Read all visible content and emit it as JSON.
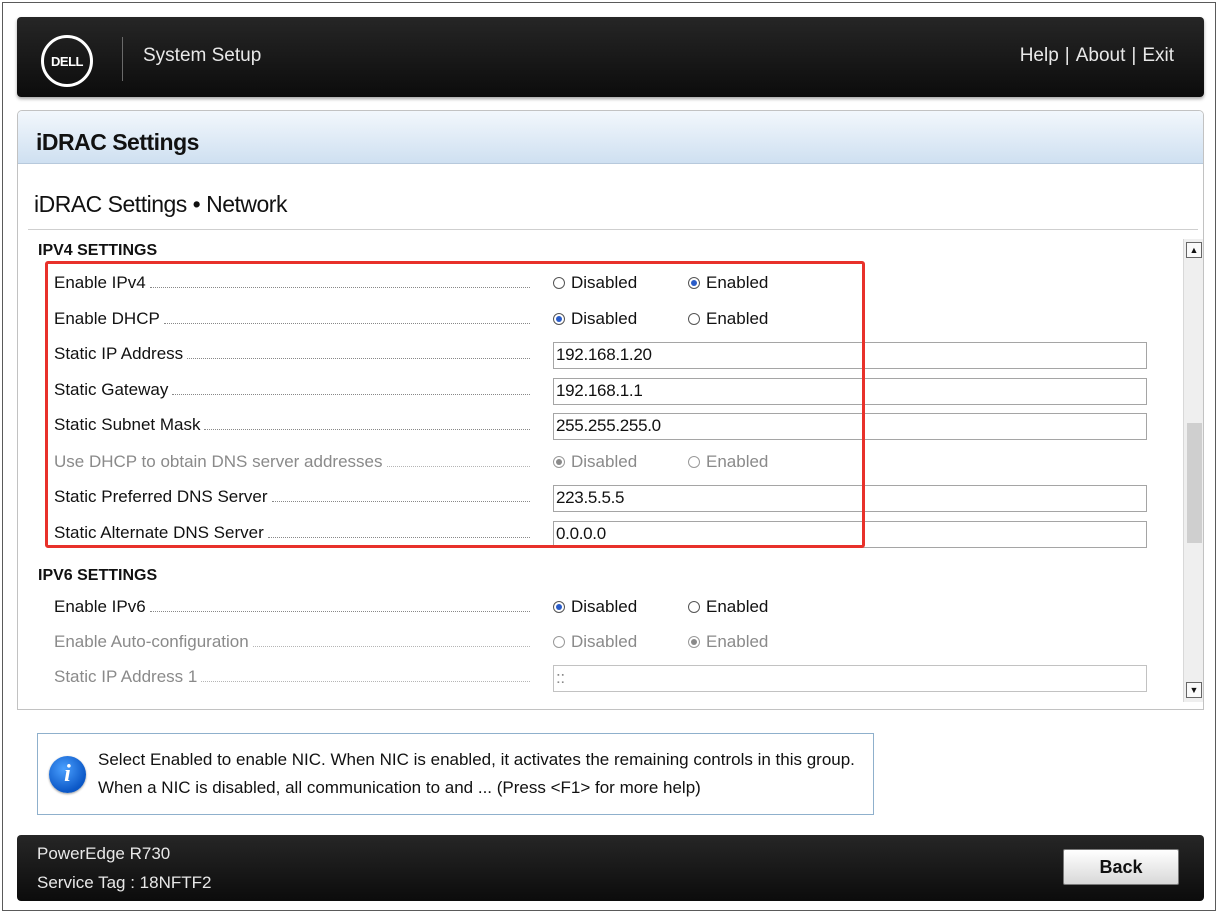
{
  "header": {
    "logo_text": "DELL",
    "title": "System Setup",
    "links": [
      "Help",
      "About",
      "Exit"
    ],
    "separator": "|"
  },
  "panel": {
    "title": "iDRAC Settings",
    "subtitle": "iDRAC Settings • Network"
  },
  "ipv4": {
    "title": "IPV4 SETTINGS",
    "enable_ipv4": {
      "label": "Enable IPv4",
      "opt1": "Disabled",
      "opt2": "Enabled",
      "selected": "Enabled"
    },
    "enable_dhcp": {
      "label": "Enable DHCP",
      "opt1": "Disabled",
      "opt2": "Enabled",
      "selected": "Disabled"
    },
    "static_ip": {
      "label": "Static IP Address",
      "value": "192.168.1.20"
    },
    "static_gateway": {
      "label": "Static Gateway",
      "value": "192.168.1.1"
    },
    "static_subnet": {
      "label": "Static Subnet Mask",
      "value": "255.255.255.0"
    },
    "dhcp_dns": {
      "label": "Use DHCP to obtain DNS server addresses",
      "opt1": "Disabled",
      "opt2": "Enabled",
      "selected": "Disabled"
    },
    "pref_dns": {
      "label": "Static Preferred DNS Server",
      "value": "223.5.5.5"
    },
    "alt_dns": {
      "label": "Static Alternate DNS Server",
      "value": "0.0.0.0"
    }
  },
  "ipv6": {
    "title": "IPV6 SETTINGS",
    "enable_ipv6": {
      "label": "Enable IPv6",
      "opt1": "Disabled",
      "opt2": "Enabled",
      "selected": "Disabled"
    },
    "auto_config": {
      "label": "Enable Auto-configuration",
      "opt1": "Disabled",
      "opt2": "Enabled",
      "selected": "Enabled"
    },
    "static_ip1": {
      "label": "Static IP Address 1",
      "value": "::"
    }
  },
  "help": {
    "text": "Select Enabled to enable NIC. When NIC is enabled, it activates the remaining controls in this group. When a NIC is disabled, all communication to and ... (Press <F1> for more help)"
  },
  "footer": {
    "model": "PowerEdge R730",
    "service_tag": "Service Tag : 18NFTF2",
    "back_label": "Back"
  },
  "colors": {
    "highlight": "#e8312a",
    "radio_selected": "#2a5cc8",
    "bar": "#1a1a1a"
  }
}
